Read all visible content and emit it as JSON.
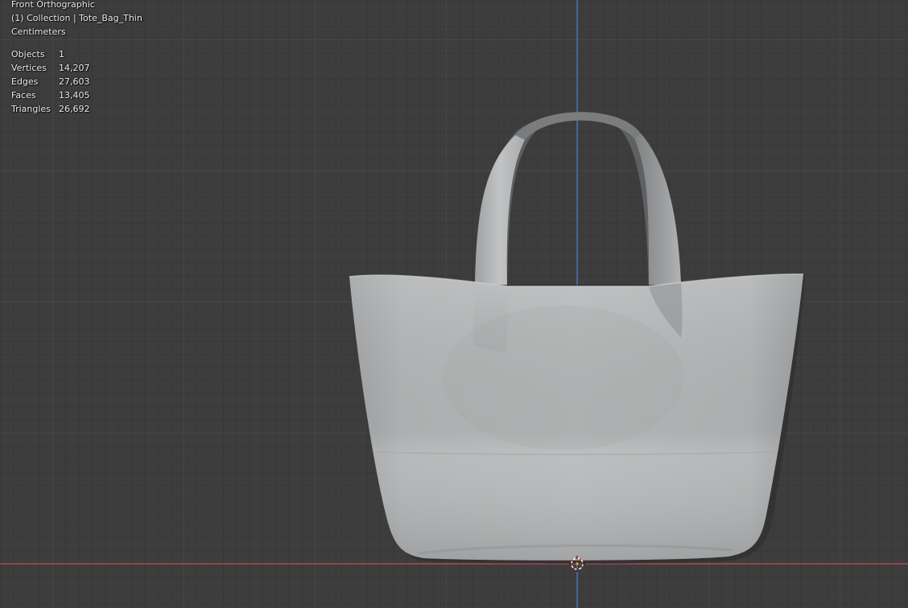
{
  "viewport": {
    "view_name": "Front Orthographic",
    "collection_line": "(1) Collection | Tote_Bag_Thin",
    "units": "Centimeters",
    "stats": [
      {
        "label": "Objects",
        "value": "1"
      },
      {
        "label": "Vertices",
        "value": "14,207"
      },
      {
        "label": "Edges",
        "value": "27,603"
      },
      {
        "label": "Faces",
        "value": "13,405"
      },
      {
        "label": "Triangles",
        "value": "26,692"
      }
    ]
  },
  "colors": {
    "grid_background": "#3d3d3d",
    "x_axis": "#c44a55",
    "z_axis": "#4a7ccf",
    "mesh_light": "#bfc1c2",
    "mesh_shadow": "#8e9091"
  },
  "icons": {
    "cursor": "3d-cursor-icon"
  }
}
